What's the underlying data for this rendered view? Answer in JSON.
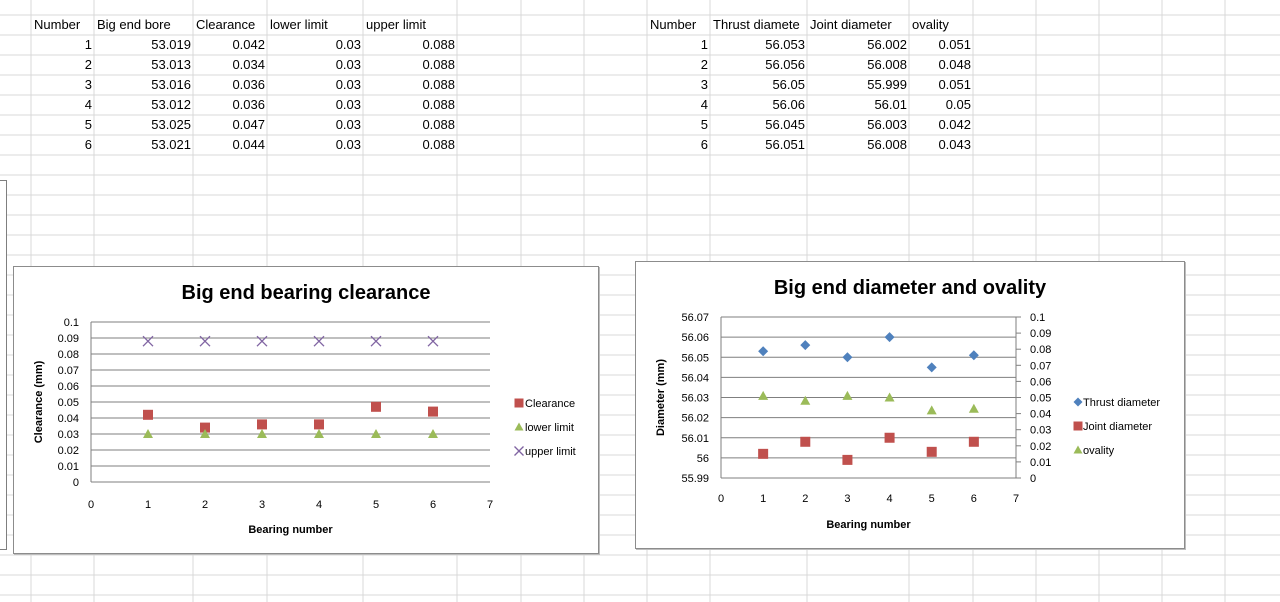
{
  "table1": {
    "headers": [
      "Number",
      "Big end bore",
      "Clearance",
      "lower limit",
      "upper limit"
    ],
    "rows": [
      [
        "1",
        "53.019",
        "0.042",
        "0.03",
        "0.088"
      ],
      [
        "2",
        "53.013",
        "0.034",
        "0.03",
        "0.088"
      ],
      [
        "3",
        "53.016",
        "0.036",
        "0.03",
        "0.088"
      ],
      [
        "4",
        "53.012",
        "0.036",
        "0.03",
        "0.088"
      ],
      [
        "5",
        "53.025",
        "0.047",
        "0.03",
        "0.088"
      ],
      [
        "6",
        "53.021",
        "0.044",
        "0.03",
        "0.088"
      ]
    ]
  },
  "table2": {
    "headers": [
      "Number",
      "Thrust diamete",
      "Joint diameter",
      "ovality"
    ],
    "rows": [
      [
        "1",
        "56.053",
        "56.002",
        "0.051"
      ],
      [
        "2",
        "56.056",
        "56.008",
        "0.048"
      ],
      [
        "3",
        "56.05",
        "55.999",
        "0.051"
      ],
      [
        "4",
        "56.06",
        "56.01",
        "0.05"
      ],
      [
        "5",
        "56.045",
        "56.003",
        "0.042"
      ],
      [
        "6",
        "56.051",
        "56.008",
        "0.043"
      ]
    ]
  },
  "colors": {
    "clearance": "#c0504d",
    "lower_limit": "#9bbb59",
    "upper_limit": "#8064a2",
    "thrust": "#4f81bd",
    "joint": "#c0504d",
    "ovality": "#9bbb59",
    "gridline": "#d9d9d9",
    "chart_gridline": "#7f7f7f"
  },
  "chart_data": [
    {
      "type": "scatter",
      "title": "Big end bearing clearance",
      "xlabel": "Bearing number",
      "ylabel": "Clearance (mm)",
      "xlim": [
        0,
        7
      ],
      "ylim": [
        0,
        0.1
      ],
      "xticks": [
        "0",
        "1",
        "2",
        "3",
        "4",
        "5",
        "6",
        "7"
      ],
      "yticks": [
        "0",
        "0.01",
        "0.02",
        "0.03",
        "0.04",
        "0.05",
        "0.06",
        "0.07",
        "0.08",
        "0.09",
        "0.1"
      ],
      "grid": true,
      "legend_position": "right",
      "x": [
        1,
        2,
        3,
        4,
        5,
        6
      ],
      "series": [
        {
          "name": "Clearance",
          "marker": "square",
          "values": [
            0.042,
            0.034,
            0.036,
            0.036,
            0.047,
            0.044
          ]
        },
        {
          "name": "lower limit",
          "marker": "triangle",
          "values": [
            0.03,
            0.03,
            0.03,
            0.03,
            0.03,
            0.03
          ]
        },
        {
          "name": "upper limit",
          "marker": "x",
          "values": [
            0.088,
            0.088,
            0.088,
            0.088,
            0.088,
            0.088
          ]
        }
      ]
    },
    {
      "type": "scatter",
      "title": "Big end diameter and ovality",
      "xlabel": "Bearing number",
      "ylabel": "Diameter (mm)",
      "xlim": [
        0,
        7
      ],
      "ylim": [
        55.99,
        56.07
      ],
      "y2lim": [
        0,
        0.1
      ],
      "xticks": [
        "0",
        "1",
        "2",
        "3",
        "4",
        "5",
        "6",
        "7"
      ],
      "yticks": [
        "55.99",
        "56",
        "56.01",
        "56.02",
        "56.03",
        "56.04",
        "56.05",
        "56.06",
        "56.07"
      ],
      "y2ticks": [
        "0",
        "0.01",
        "0.02",
        "0.03",
        "0.04",
        "0.05",
        "0.06",
        "0.07",
        "0.08",
        "0.09",
        "0.1"
      ],
      "grid": true,
      "legend_position": "right",
      "x": [
        1,
        2,
        3,
        4,
        5,
        6
      ],
      "series": [
        {
          "name": "Thrust diameter",
          "marker": "diamond",
          "axis": "primary",
          "values": [
            56.053,
            56.056,
            56.05,
            56.06,
            56.045,
            56.051
          ]
        },
        {
          "name": "Joint diameter",
          "marker": "square",
          "axis": "primary",
          "values": [
            56.002,
            56.008,
            55.999,
            56.01,
            56.003,
            56.008
          ]
        },
        {
          "name": "ovality",
          "marker": "triangle",
          "axis": "secondary",
          "values": [
            0.051,
            0.048,
            0.051,
            0.05,
            0.042,
            0.043
          ]
        }
      ]
    }
  ]
}
